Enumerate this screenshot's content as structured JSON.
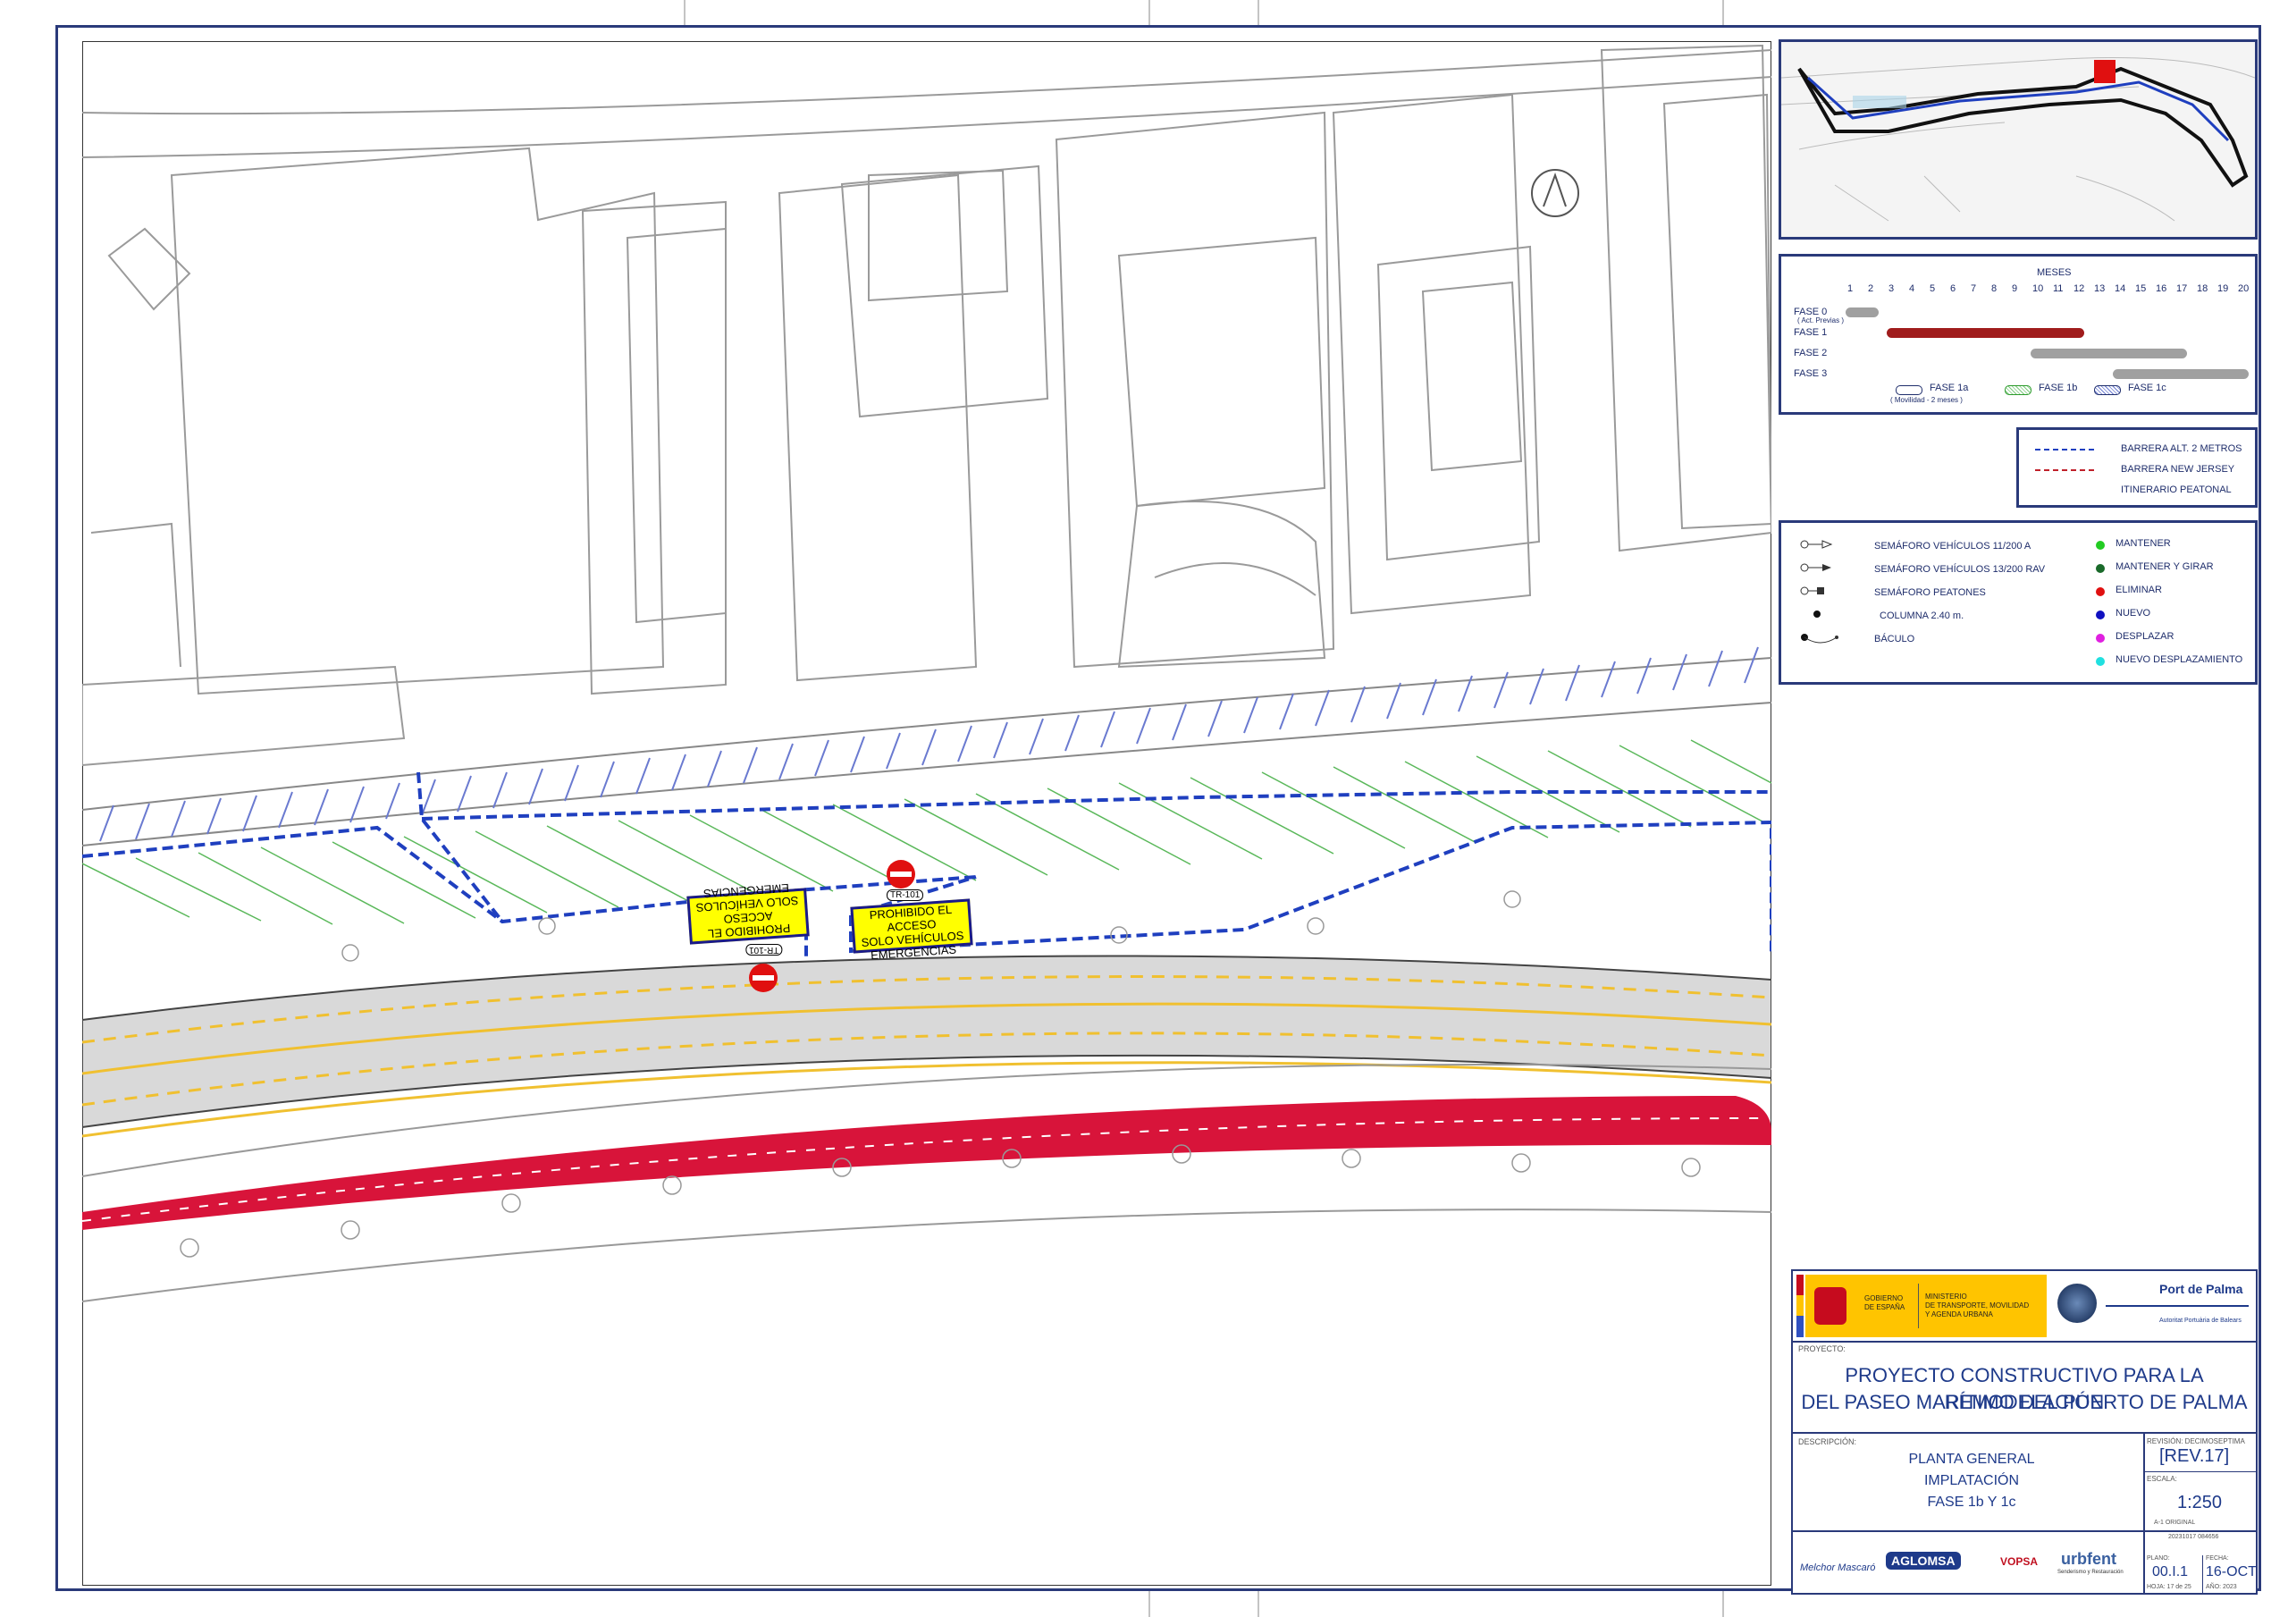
{
  "schedule": {
    "header": "MESES",
    "months": [
      "1",
      "2",
      "3",
      "4",
      "5",
      "6",
      "7",
      "8",
      "9",
      "10",
      "11",
      "12",
      "13",
      "14",
      "15",
      "16",
      "17",
      "18",
      "19",
      "20"
    ],
    "phases": [
      {
        "label": "FASE 0",
        "sublabel": "( Act. Previas )",
        "start": 1,
        "end": 2,
        "color": "#a0a0a0"
      },
      {
        "label": "FASE 1",
        "sublabel": "",
        "start": 3,
        "end": 12,
        "color": "#a01c1c"
      },
      {
        "label": "FASE 2",
        "sublabel": "",
        "start": 10,
        "end": 17,
        "color": "#a0a0a0"
      },
      {
        "label": "FASE 3",
        "sublabel": "",
        "start": 14,
        "end": 20,
        "color": "#a0a0a0"
      }
    ],
    "legend": [
      {
        "label": "FASE 1a",
        "sublabel": "( Movilidad - 2 meses )"
      },
      {
        "label": "FASE 1b",
        "sublabel": ""
      },
      {
        "label": "FASE 1c",
        "sublabel": ""
      }
    ]
  },
  "barriers": [
    {
      "label": "BARRERA ALT. 2 METROS",
      "color": "#2040c0"
    },
    {
      "label": "BARRERA NEW JERSEY",
      "color": "#c0202a"
    },
    {
      "label": "ITINERARIO  PEATONAL",
      "color": ""
    }
  ],
  "symbols_left": [
    "SEMÁFORO VEHÍCULOS 11/200 A",
    "SEMÁFORO VEHÍCULOS 13/200 RAV",
    "SEMÁFORO PEATONES",
    "COLUMNA 2.40 m.",
    "BÁCULO"
  ],
  "symbols_right": [
    {
      "label": "MANTENER",
      "color": "#22cc22"
    },
    {
      "label": "MANTENER Y GIRAR",
      "color": "#1a6a2a"
    },
    {
      "label": "ELIMINAR",
      "color": "#e01010"
    },
    {
      "label": "NUEVO",
      "color": "#1010c0"
    },
    {
      "label": "DESPLAZAR",
      "color": "#e020e0"
    },
    {
      "label": "NUEVO DESPLAZAMIENTO",
      "color": "#20e0e0"
    }
  ],
  "signs": {
    "sign_upright": [
      "PROHIBIDO EL ACCESO",
      "SOLO VEHÍCULOS",
      "EMERGENCIAS"
    ],
    "sign_inverted": [
      "PROHIBIDO EL ACCESO",
      "SOLO VEHÍCULOS",
      "EMERGENCIAS"
    ],
    "code": "TR-101"
  },
  "titleblock": {
    "gov1": "GOBIERNO\nDE ESPAÑA",
    "gov2": "MINISTERIO\nDE TRANSPORTE, MOVILIDAD\nY AGENDA URBANA",
    "port": "Port de Palma",
    "port_sub": "Autoritat Portuària de Balears",
    "proyecto_label": "PROYECTO:",
    "proyecto_line1": "PROYECTO CONSTRUCTIVO PARA LA REMODELACIÓN",
    "proyecto_line2": "DEL PASEO MARÍTIMO DEL PUERTO DE PALMA",
    "descripcion_label": "DESCRIPCIÓN:",
    "desc_line1": "PLANTA GENERAL",
    "desc_line2": "IMPLATACIÓN",
    "desc_line3": "FASE 1b Y 1c",
    "revision_label": "REVISIÓN: DECIMOSEPTIMA",
    "revision": "[REV.17]",
    "escala_label": "ESCALA:",
    "escala": "1:250",
    "formato": "A-1 ORIGINAL",
    "file_code": "20231017 084656",
    "plano_label": "PLANO:",
    "plano": "00.I.1",
    "hoja": "HOJA: 17 de 25",
    "fecha_label": "FECHA:",
    "fecha": "16-OCT",
    "anio": "AÑO: 2023",
    "logos": [
      "Melchor Mascaró",
      "AGLOMSA",
      "VOPSA",
      "urbfent"
    ],
    "logo_sub": "Senderismo y Restauración"
  }
}
